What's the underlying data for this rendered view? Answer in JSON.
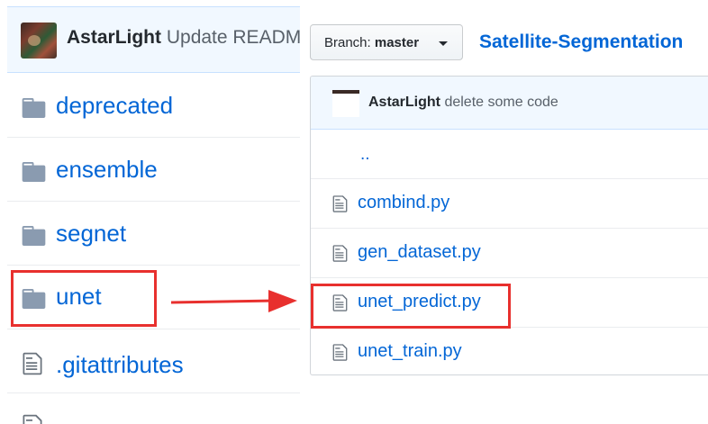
{
  "left_panel": {
    "commit": {
      "author": "AstarLight",
      "message": "Update READM"
    },
    "items": [
      {
        "name": "deprecated",
        "type": "folder"
      },
      {
        "name": "ensemble",
        "type": "folder"
      },
      {
        "name": "segnet",
        "type": "folder"
      },
      {
        "name": "unet",
        "type": "folder"
      },
      {
        "name": ".gitattributes",
        "type": "file"
      }
    ]
  },
  "branch": {
    "label": "Branch:",
    "value": "master"
  },
  "repo": {
    "name": "Satellite-Segmentation"
  },
  "right_panel": {
    "commit": {
      "author": "AstarLight",
      "message": "delete some code"
    },
    "parent_dir": "..",
    "files": [
      {
        "name": "combind.py"
      },
      {
        "name": "gen_dataset.py"
      },
      {
        "name": "unet_predict.py"
      },
      {
        "name": "unet_train.py"
      }
    ]
  },
  "annotation": {
    "color": "#e8302e",
    "highlighted_folder": "unet",
    "highlighted_file": "unet_predict.py"
  },
  "icons": {
    "folder": "folder-icon",
    "file": "file-icon",
    "caret": "caret-down-icon"
  },
  "colors": {
    "link": "#0366d6",
    "commit_bg": "#f1f8ff",
    "folder_icon": "#79b8ff"
  }
}
